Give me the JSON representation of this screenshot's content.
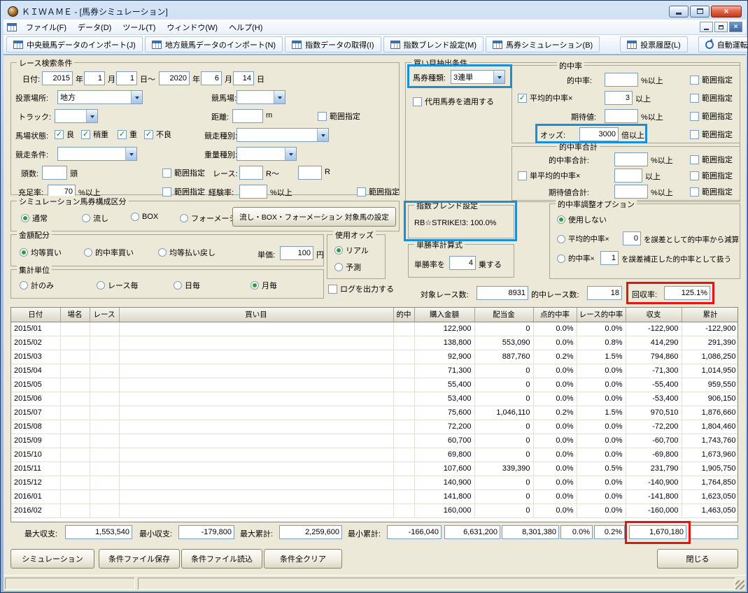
{
  "window": {
    "title": "ＫＩＷＡＭＥ - [馬券シミュレーション]"
  },
  "icons": {
    "close": "×"
  },
  "menu": [
    "ファイル(F)",
    "データ(D)",
    "ツール(T)",
    "ウィンドウ(W)",
    "ヘルプ(H)"
  ],
  "toolbar": [
    "中央競馬データのインポート(J)",
    "地方競馬データのインポート(N)",
    "指数データの取得(I)",
    "指数ブレンド設定(M)",
    "馬券シミュレーション(B)",
    "投票履歴(L)",
    "自動運転(A)"
  ],
  "labels": {
    "range": "範囲指定",
    "pct_up": "%以上",
    "ge": "以上"
  },
  "search": {
    "title": "レース検索条件",
    "date_label": "日付:",
    "year1": "2015",
    "year_unit": "年",
    "month1": "1",
    "month_unit": "月",
    "day1": "1",
    "day_unit1": "日～",
    "year2": "2020",
    "month2": "6",
    "day2": "14",
    "day_unit2": "日",
    "place_label": "投票場所:",
    "place_value": "地方",
    "course_label": "競馬場:",
    "track_label": "トラック:",
    "distance_label": "距離:",
    "distance_unit": "m",
    "baba_label": "馬場状態:",
    "baba_good": "良",
    "baba_yayaomo": "稍重",
    "baba_omo": "重",
    "baba_bad": "不良",
    "race_type_label": "競走種別:",
    "race_cond_label": "競走条件:",
    "weight_label": "重量種別:",
    "heads_label": "頭数:",
    "heads_unit": "頭",
    "race_label": "レース:",
    "race_unit1": "R～",
    "race_unit2": "R",
    "fill_label": "充足率:",
    "fill_value": "70",
    "exp_label": "経験率:"
  },
  "extract": {
    "title": "買い目抽出条件",
    "ticket_label": "馬券種類:",
    "ticket_value": "3連単",
    "substitute_label": "代用馬券を適用する",
    "hit_title": "的中率",
    "hit_label": "的中率:",
    "avg_label": "平均的中率×",
    "avg_value": "3",
    "expect_label": "期待値:",
    "odds_label": "オッズ:",
    "odds_value": "3000",
    "odds_unit": "倍以上",
    "total_title": "的中率合計",
    "total_label": "的中率合計:",
    "single_avg_label": "単平均的中率×",
    "expect_total_label": "期待値合計:"
  },
  "sim": {
    "title": "シミュレーション馬券構成区分",
    "opts": [
      "通常",
      "流し",
      "BOX",
      "フォーメーション"
    ],
    "target_button": "流し・BOX・フォーメーション 対象馬の設定"
  },
  "amount": {
    "title": "金額配分",
    "opts": [
      "均等買い",
      "的中率買い",
      "均等払い戻し"
    ],
    "unit_label": "単価:",
    "unit_value": "100",
    "unit_suffix": "円"
  },
  "odds_use": {
    "title": "使用オッズ",
    "opts": [
      "リアル",
      "予測"
    ]
  },
  "agg": {
    "title": "集計単位",
    "opts": [
      "計のみ",
      "レース毎",
      "日毎",
      "月毎"
    ]
  },
  "blend": {
    "title": "指数ブレンド設定",
    "value": "RB☆STRIKE!3: 100.0%"
  },
  "winrate": {
    "title": "単勝率計算式",
    "prefix": "単勝率を",
    "value": "4",
    "suffix": "乗する"
  },
  "adjust": {
    "title": "的中率調整オプション",
    "none_label": "使用しない",
    "opt1_label": "平均的中率×",
    "opt1_value": "0",
    "opt1_suffix": "を誤差として的中率から減算",
    "opt2_label": "的中率×",
    "opt2_value": "1",
    "opt2_suffix": "を誤差補正した的中率として扱う"
  },
  "log_label": "ログを出力する",
  "stats": {
    "target_label": "対象レース数:",
    "target_value": "8931",
    "hit_label": "的中レース数:",
    "hit_value": "18",
    "recovery_label": "回収率:",
    "recovery_value": "125.1%"
  },
  "table": {
    "columns": [
      "日付",
      "場名",
      "レース",
      "買い目",
      "的中",
      "購入金額",
      "配当金",
      "点的中率",
      "レース的中率",
      "収支",
      "累計"
    ],
    "rows": [
      [
        "2015/01",
        "",
        "",
        "",
        "",
        "122,900",
        "0",
        "0.0%",
        "0.0%",
        "-122,900",
        "-122,900"
      ],
      [
        "2015/02",
        "",
        "",
        "",
        "",
        "138,800",
        "553,090",
        "0.0%",
        "0.8%",
        "414,290",
        "291,390"
      ],
      [
        "2015/03",
        "",
        "",
        "",
        "",
        "92,900",
        "887,760",
        "0.2%",
        "1.5%",
        "794,860",
        "1,086,250"
      ],
      [
        "2015/04",
        "",
        "",
        "",
        "",
        "71,300",
        "0",
        "0.0%",
        "0.0%",
        "-71,300",
        "1,014,950"
      ],
      [
        "2015/05",
        "",
        "",
        "",
        "",
        "55,400",
        "0",
        "0.0%",
        "0.0%",
        "-55,400",
        "959,550"
      ],
      [
        "2015/06",
        "",
        "",
        "",
        "",
        "53,400",
        "0",
        "0.0%",
        "0.0%",
        "-53,400",
        "906,150"
      ],
      [
        "2015/07",
        "",
        "",
        "",
        "",
        "75,600",
        "1,046,110",
        "0.2%",
        "1.5%",
        "970,510",
        "1,876,660"
      ],
      [
        "2015/08",
        "",
        "",
        "",
        "",
        "72,200",
        "0",
        "0.0%",
        "0.0%",
        "-72,200",
        "1,804,460"
      ],
      [
        "2015/09",
        "",
        "",
        "",
        "",
        "60,700",
        "0",
        "0.0%",
        "0.0%",
        "-60,700",
        "1,743,760"
      ],
      [
        "2015/10",
        "",
        "",
        "",
        "",
        "69,800",
        "0",
        "0.0%",
        "0.0%",
        "-69,800",
        "1,673,960"
      ],
      [
        "2015/11",
        "",
        "",
        "",
        "",
        "107,600",
        "339,390",
        "0.0%",
        "0.5%",
        "231,790",
        "1,905,750"
      ],
      [
        "2015/12",
        "",
        "",
        "",
        "",
        "140,900",
        "0",
        "0.0%",
        "0.0%",
        "-140,900",
        "1,764,850"
      ],
      [
        "2016/01",
        "",
        "",
        "",
        "",
        "141,800",
        "0",
        "0.0%",
        "0.0%",
        "-141,800",
        "1,623,050"
      ],
      [
        "2016/02",
        "",
        "",
        "",
        "",
        "160,000",
        "0",
        "0.0%",
        "0.0%",
        "-160,000",
        "1,463,050"
      ]
    ]
  },
  "summary": {
    "max_balance_label": "最大収支:",
    "max_balance": "1,553,540",
    "min_balance_label": "最小収支:",
    "min_balance": "-179,800",
    "max_total_label": "最大累計:",
    "max_total": "2,259,600",
    "min_total_label": "最小累計:",
    "min_total": "-166,040",
    "purchase_total": "6,631,200",
    "payout_total": "8,301,380",
    "point_rate": "0.0%",
    "race_rate": "0.2%",
    "balance_total": "1,670,180"
  },
  "footer": {
    "simulate": "シミュレーション",
    "save": "条件ファイル保存",
    "load": "条件ファイル読込",
    "clear": "条件全クリア",
    "close": "閉じる"
  }
}
